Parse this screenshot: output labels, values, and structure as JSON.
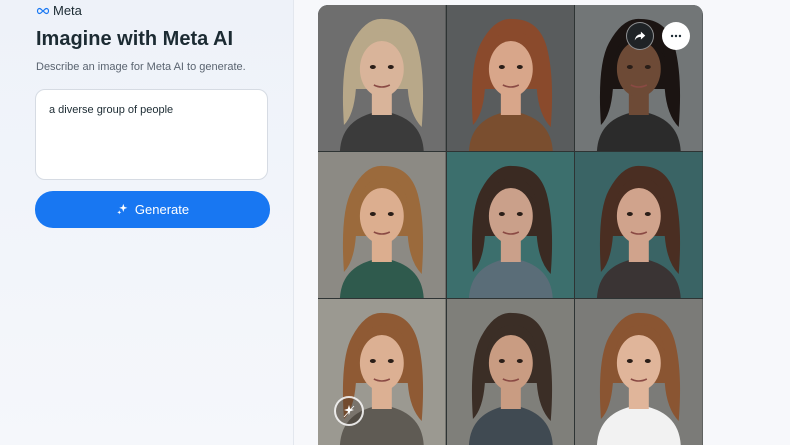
{
  "brand": {
    "name": "Meta",
    "accent": "#1877f2"
  },
  "page": {
    "title": "Imagine with Meta AI",
    "subtitle": "Describe an image for Meta AI to generate."
  },
  "prompt": {
    "value": "a diverse group of people"
  },
  "generate": {
    "label": "Generate",
    "icon": "sparkle-icon"
  },
  "image_actions": {
    "share_icon": "share-icon",
    "more_icon": "more-options-icon"
  },
  "gallery": {
    "portraits": [
      {
        "hair": "#b8a889",
        "bg": "#6e6e6e",
        "skin": "#d9b49a",
        "cloth": "#3b3b3b"
      },
      {
        "hair": "#8a4a2c",
        "bg": "#595c5d",
        "skin": "#d8a68a",
        "cloth": "#7a4e2f"
      },
      {
        "hair": "#1b1412",
        "bg": "#727677",
        "skin": "#6d4a36",
        "cloth": "#2b2b2b"
      },
      {
        "hair": "#9b6a3c",
        "bg": "#8c8a84",
        "skin": "#dcae8f",
        "cloth": "#2f5a4d"
      },
      {
        "hair": "#3a2a22",
        "bg": "#3c6f6d",
        "skin": "#caa08a",
        "cloth": "#5a6d78"
      },
      {
        "hair": "#4a2e22",
        "bg": "#3a6465",
        "skin": "#d0a38c",
        "cloth": "#3a3434"
      },
      {
        "hair": "#8f5a34",
        "bg": "#9b9991",
        "skin": "#dcb093",
        "cloth": "#5f5b54"
      },
      {
        "hair": "#3b2e26",
        "bg": "#7f7f7a",
        "skin": "#c99c82",
        "cloth": "#404a52"
      },
      {
        "hair": "#8a5532",
        "bg": "#7b7b78",
        "skin": "#e0b59a",
        "cloth": "#f2f2f2"
      }
    ]
  }
}
